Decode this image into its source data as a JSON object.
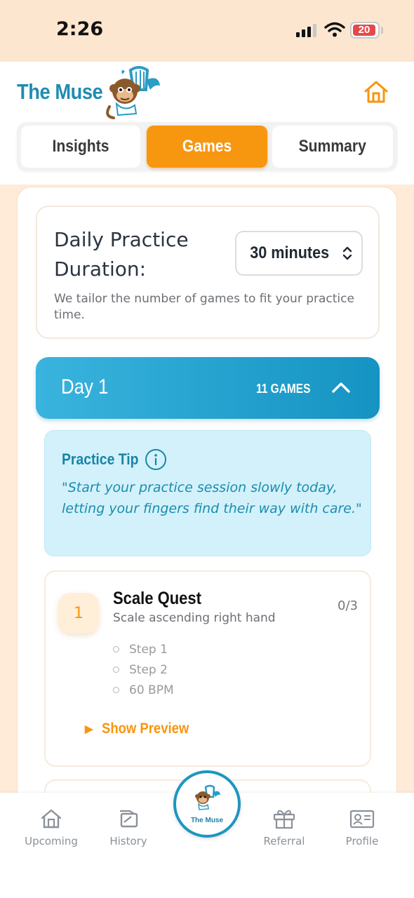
{
  "status_bar": {
    "time": "2:26",
    "battery": "20"
  },
  "header": {
    "brand": "The Muse",
    "home_icon": "home-icon"
  },
  "tabs": [
    {
      "label": "Insights",
      "active": false
    },
    {
      "label": "Games",
      "active": true
    },
    {
      "label": "Summary",
      "active": false
    }
  ],
  "practice": {
    "title": "Daily Practice Duration:",
    "selected_duration": "30 minutes",
    "description": "We tailor the number of games to fit your practice time."
  },
  "day": {
    "title": "Day 1",
    "games_count": "11 GAMES",
    "expanded": true
  },
  "tip": {
    "title": "Practice Tip",
    "quote": "\"Start your practice session slowly today, letting your fingers find their way with care.\""
  },
  "games": [
    {
      "number": "1",
      "title": "Scale Quest",
      "subtitle": "Scale ascending right hand",
      "progress": "0/3",
      "steps": [
        "Step 1",
        "Step 2",
        "60 BPM"
      ],
      "preview_label": "Show Preview"
    }
  ],
  "bottom_nav": {
    "upcoming": "Upcoming",
    "history": "History",
    "center": "The Muse",
    "referral": "Referral",
    "profile": "Profile"
  },
  "colors": {
    "accent_orange": "#F7960F",
    "brand_blue": "#1F8DB0",
    "day_blue": "#1593C2",
    "tip_bg": "#D3F1FA",
    "page_bg": "#FFEBD8"
  }
}
